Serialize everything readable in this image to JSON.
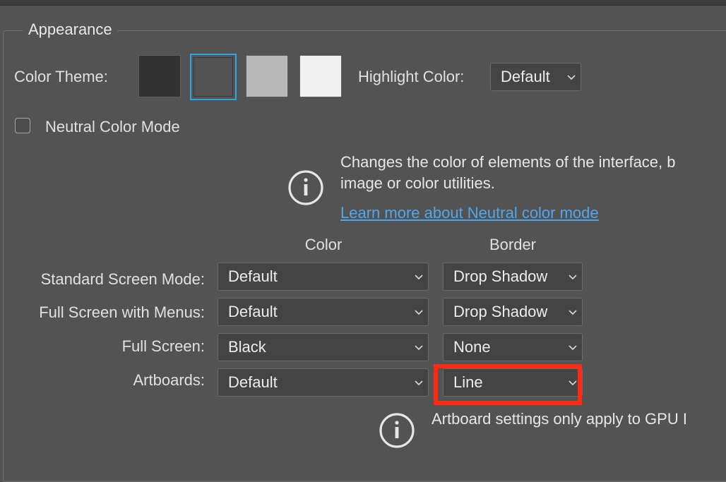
{
  "appearance": {
    "title": "Appearance",
    "color_theme_label": "Color Theme:",
    "swatches": [
      {
        "name": "darkest",
        "color": "#323232",
        "selected": false
      },
      {
        "name": "dark",
        "color": "#535353",
        "selected": true
      },
      {
        "name": "medium-gray",
        "color": "#b8b8b8",
        "selected": false
      },
      {
        "name": "light",
        "color": "#f0f0f0",
        "selected": false
      }
    ],
    "highlight_color_label": "Highlight Color:",
    "highlight_color_value": "Default",
    "neutral_color_mode_label": "Neutral Color Mode",
    "neutral_color_mode_checked": false,
    "neutral_description_line1": "Changes the color of elements of the interface, b",
    "neutral_description_line2": "image or color utilities.",
    "neutral_learn_more": "Learn more about Neutral color mode"
  },
  "screen_modes": {
    "color_header": "Color",
    "border_header": "Border",
    "rows": [
      {
        "label": "Standard Screen Mode:",
        "color": "Default",
        "border": "Drop Shadow"
      },
      {
        "label": "Full Screen with Menus:",
        "color": "Default",
        "border": "Drop Shadow"
      },
      {
        "label": "Full Screen:",
        "color": "Black",
        "border": "None"
      },
      {
        "label": "Artboards:",
        "color": "Default",
        "border": "Line"
      }
    ],
    "artboard_note": "Artboard settings only apply to GPU I"
  },
  "colors": {
    "panel_bg": "#535353",
    "selection_accent": "#2fa5e8",
    "link": "#4ea6ee",
    "annotation_highlight": "#ff2a12"
  }
}
